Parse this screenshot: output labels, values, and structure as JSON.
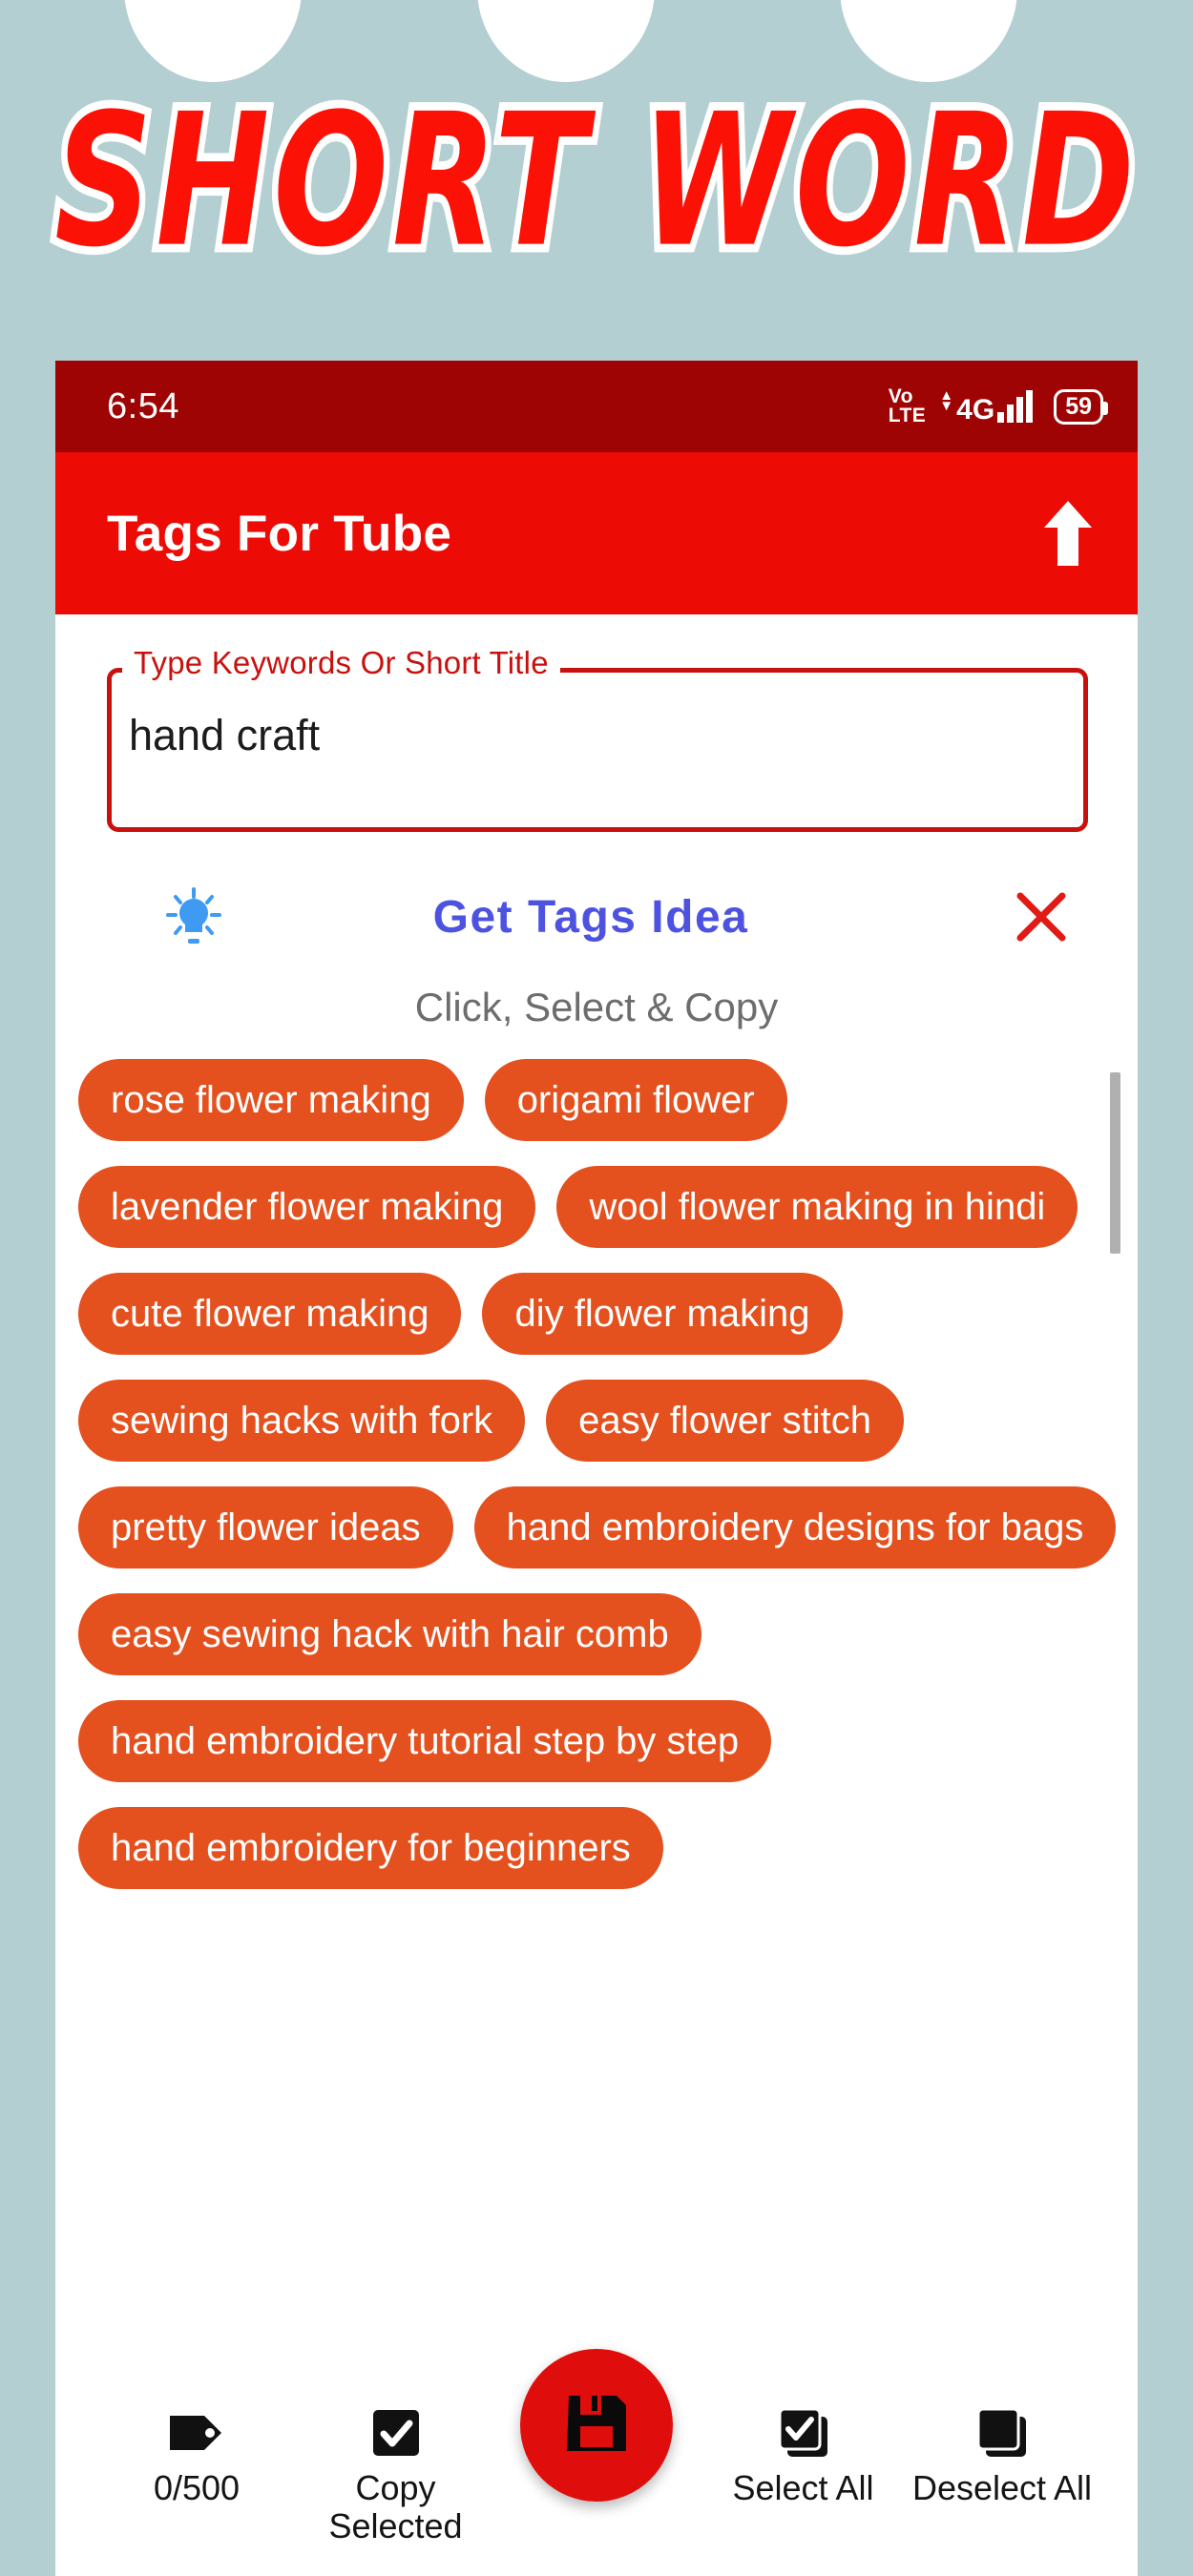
{
  "banner": {
    "text": "SHORT WORD",
    "text_color": "#fb1106",
    "outline_color": "#ffffff"
  },
  "page": {
    "background_color": "#b3cfd2"
  },
  "statusbar": {
    "time": "6:54",
    "volte_top": "Vo",
    "volte_bottom": "LTE",
    "network": "4G",
    "battery_level": "59",
    "background_color": "#9e0403"
  },
  "appbar": {
    "title": "Tags For Tube",
    "upload_icon": "arrow-up-icon",
    "background_color": "#ed0b05"
  },
  "input": {
    "label": "Type Keywords Or Short Title",
    "value": "hand craft",
    "placeholder": "Type Keywords Or Short Title",
    "border_color": "#c8110d"
  },
  "idea": {
    "bulb_icon": "lightbulb-icon",
    "title": "Get Tags Idea",
    "title_color": "#4d53e0",
    "close_icon": "close-x-icon",
    "subtitle": "Click, Select & Copy"
  },
  "tags": {
    "chip_color": "#e4501e",
    "items": [
      "rose flower making",
      "origami flower",
      "lavender flower making",
      "wool flower making in hindi",
      "cute flower making",
      "diy flower making",
      "sewing hacks with fork",
      "easy flower stitch",
      "pretty flower ideas",
      "hand embroidery designs for bags",
      "easy sewing hack with hair comb",
      "hand embroidery tutorial step by step",
      "hand embroidery for beginners"
    ]
  },
  "bottombar": {
    "counter_icon": "tag-icon",
    "counter": "0/500",
    "copy_icon": "checkbox-checked-icon",
    "copy_label": "Copy\nSelected",
    "copy_label_line1": "Copy",
    "copy_label_line2": "Selected",
    "save_icon": "floppy-save-icon",
    "select_all_icon": "select-all-icon",
    "select_all_label": "Select All",
    "deselect_all_icon": "deselect-all-icon",
    "deselect_all_label": "Deselect All",
    "fab_color": "#e00d0d"
  }
}
